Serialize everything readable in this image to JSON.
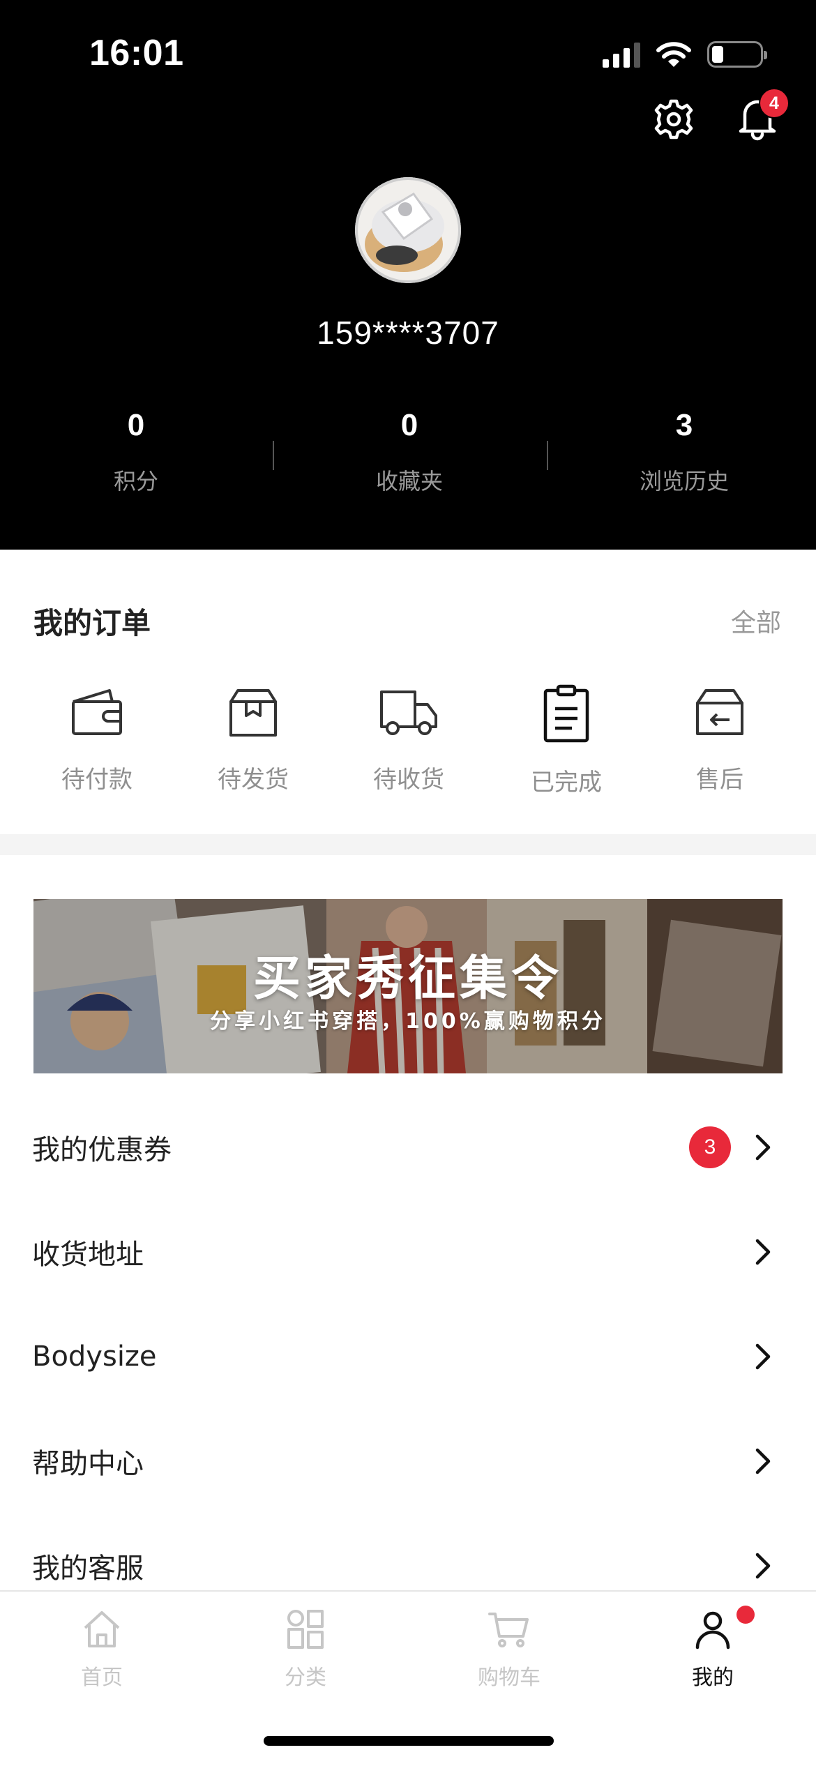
{
  "status_bar": {
    "time": "16:01"
  },
  "header": {
    "notification_count": "4",
    "username": "159****3707",
    "stats": [
      {
        "value": "0",
        "label": "积分"
      },
      {
        "value": "0",
        "label": "收藏夹"
      },
      {
        "value": "3",
        "label": "浏览历史"
      }
    ]
  },
  "orders": {
    "title": "我的订单",
    "all_label": "全部",
    "items": [
      {
        "label": "待付款",
        "icon": "wallet-icon"
      },
      {
        "label": "待发货",
        "icon": "package-icon"
      },
      {
        "label": "待收货",
        "icon": "truck-icon"
      },
      {
        "label": "已完成",
        "icon": "clipboard-icon"
      },
      {
        "label": "售后",
        "icon": "return-box-icon"
      }
    ]
  },
  "banner": {
    "title": "买家秀征集令",
    "subtitle": "分享小红书穿搭，100%赢购物积分"
  },
  "menu": {
    "items": [
      {
        "label": "我的优惠券",
        "badge": "3"
      },
      {
        "label": "收货地址"
      },
      {
        "label": "Bodysize"
      },
      {
        "label": "帮助中心"
      },
      {
        "label": "我的客服"
      }
    ]
  },
  "tabbar": {
    "items": [
      {
        "label": "首页",
        "icon": "home-icon"
      },
      {
        "label": "分类",
        "icon": "category-icon"
      },
      {
        "label": "购物车",
        "icon": "cart-icon"
      },
      {
        "label": "我的",
        "icon": "person-icon",
        "active": true
      }
    ]
  },
  "colors": {
    "accent_red": "#e8293a",
    "header_bg": "#000000",
    "muted_text": "#999999"
  }
}
